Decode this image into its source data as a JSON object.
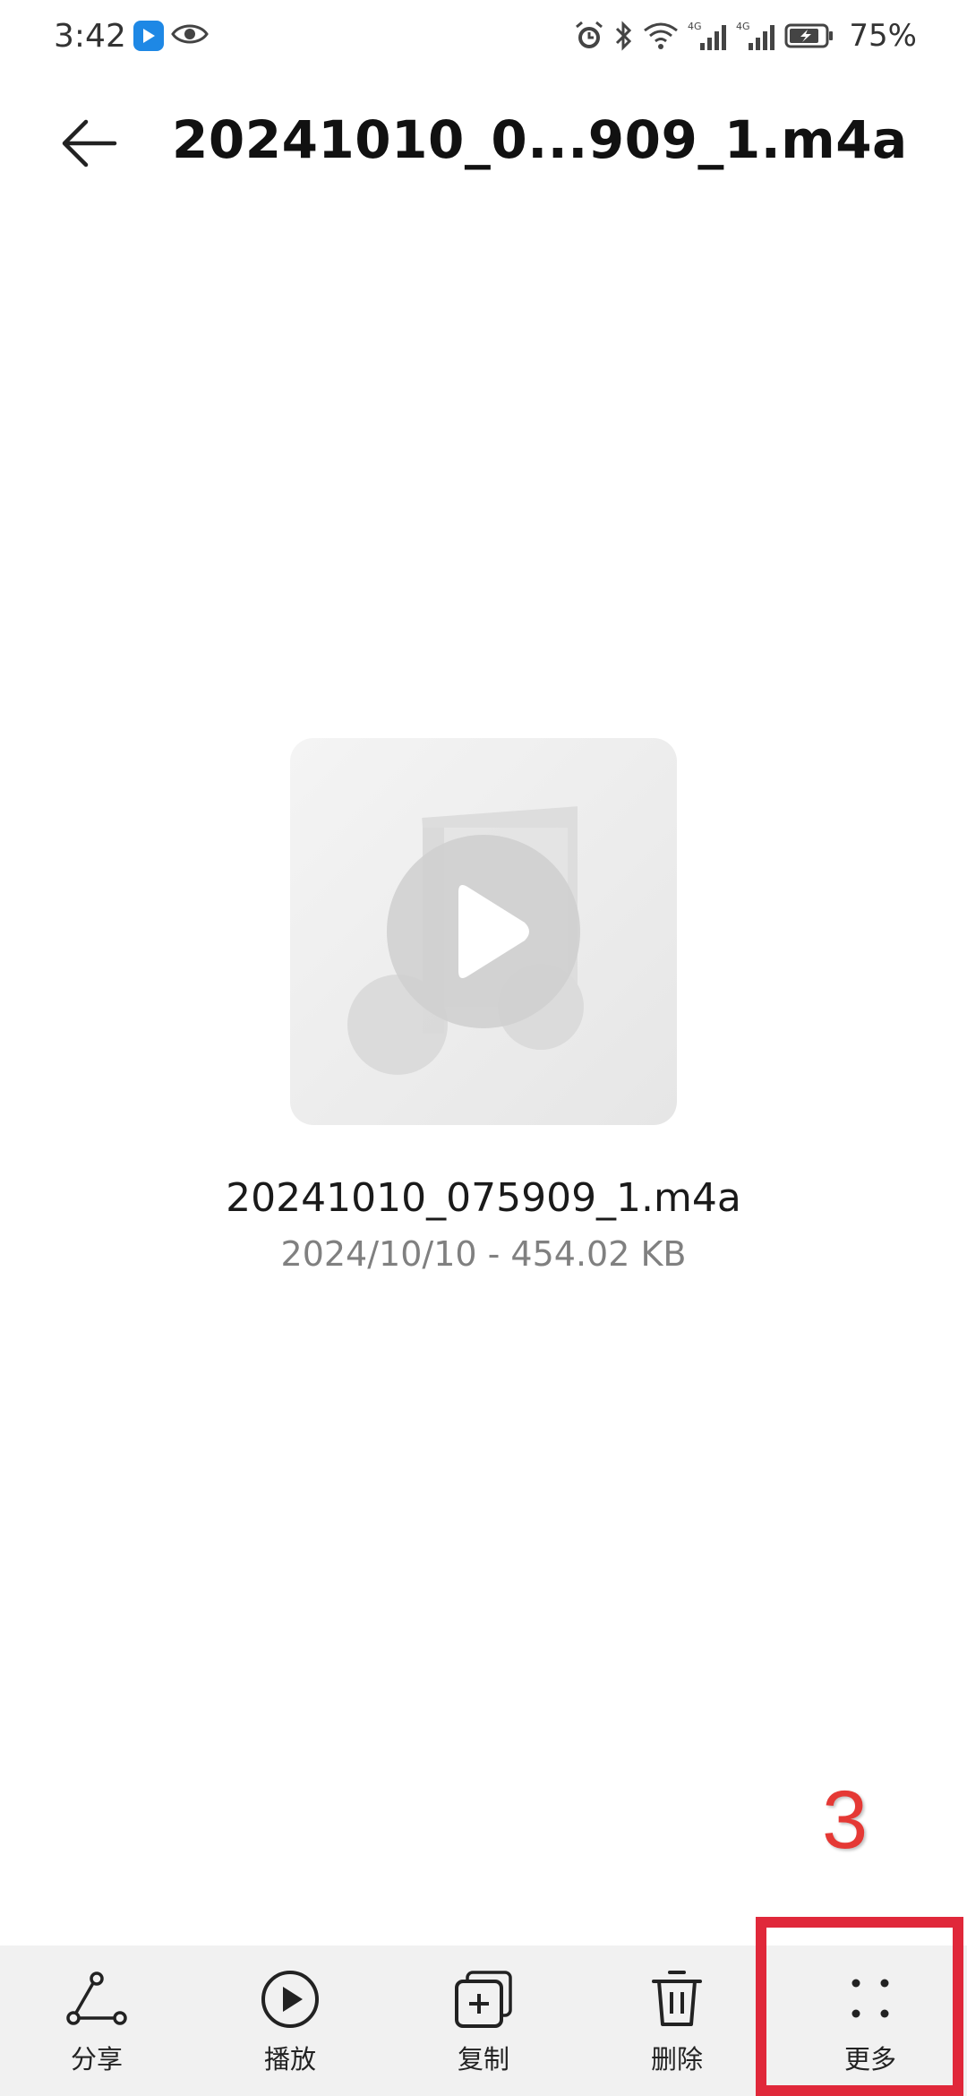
{
  "status": {
    "time": "3:42",
    "battery": "75%",
    "signal_label_1": "4G",
    "signal_label_2": "4G"
  },
  "header": {
    "title": "20241010_0...909_1.m4a"
  },
  "file": {
    "name": "20241010_075909_1.m4a",
    "meta": "2024/10/10 - 454.02 KB"
  },
  "annotation": {
    "number": "3"
  },
  "actions": [
    {
      "label": "分享",
      "icon": "share-icon"
    },
    {
      "label": "播放",
      "icon": "play-icon"
    },
    {
      "label": "复制",
      "icon": "copy-icon"
    },
    {
      "label": "删除",
      "icon": "delete-icon"
    },
    {
      "label": "更多",
      "icon": "more-icon"
    }
  ],
  "colors": {
    "annotation_red": "#e0283a",
    "bottom_bar_bg": "#f1f1f1",
    "meta_text": "#808080"
  }
}
